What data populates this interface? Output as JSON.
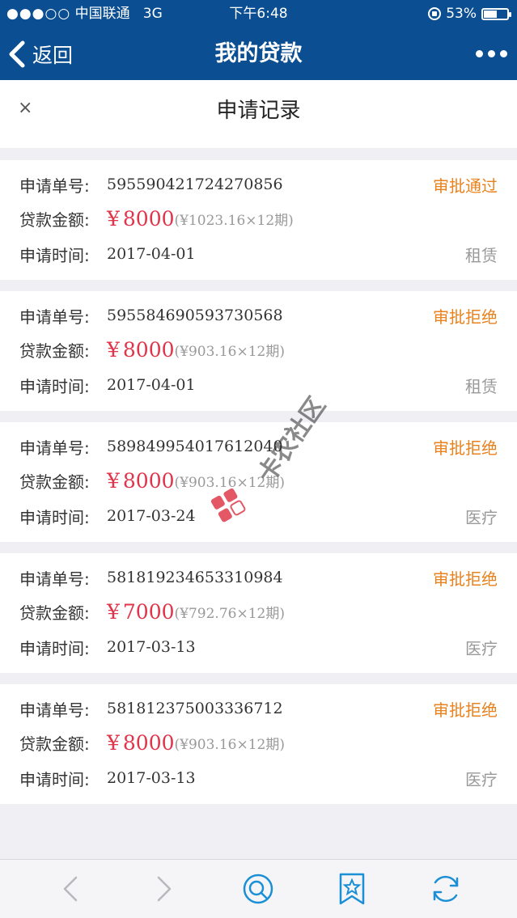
{
  "status_bar": {
    "signal": "●●●○○",
    "carrier": "中国联通",
    "network": "3G",
    "time": "下午6:48",
    "battery_pct": "53%"
  },
  "nav": {
    "back_label": "返回",
    "title": "我的贷款"
  },
  "sheet": {
    "close_glyph": "×",
    "title": "申请记录"
  },
  "labels": {
    "order_no": "申请单号:",
    "amount": "贷款金额:",
    "time": "申请时间:"
  },
  "records": [
    {
      "order_no": "595590421724270856",
      "status": "审批通过",
      "currency": "¥",
      "amount": "8000",
      "term": "(¥1023.16×12期)",
      "date": "2017-04-01",
      "category": "租赁"
    },
    {
      "order_no": "595584690593730568",
      "status": "审批拒绝",
      "currency": "¥",
      "amount": "8000",
      "term": "(¥903.16×12期)",
      "date": "2017-04-01",
      "category": "租赁"
    },
    {
      "order_no": "589849954017612040",
      "status": "审批拒绝",
      "currency": "¥",
      "amount": "8000",
      "term": "(¥903.16×12期)",
      "date": "2017-03-24",
      "category": "医疗"
    },
    {
      "order_no": "581819234653310984",
      "status": "审批拒绝",
      "currency": "¥",
      "amount": "7000",
      "term": "(¥792.76×12期)",
      "date": "2017-03-13",
      "category": "医疗"
    },
    {
      "order_no": "581812375003336712",
      "status": "审批拒绝",
      "currency": "¥",
      "amount": "8000",
      "term": "(¥903.16×12期)",
      "date": "2017-03-13",
      "category": "医疗"
    }
  ],
  "watermark": {
    "text": "卡农社区"
  },
  "toolbar": {
    "icons": [
      "back-arrow-icon",
      "forward-arrow-icon",
      "search-icon",
      "bookmark-star-icon",
      "refresh-icon"
    ]
  },
  "colors": {
    "nav_bg": "#0b4f92",
    "status_color": "#e8821e",
    "amount_color": "#e0344a",
    "toolbar_icon": "#1a8fd6"
  }
}
